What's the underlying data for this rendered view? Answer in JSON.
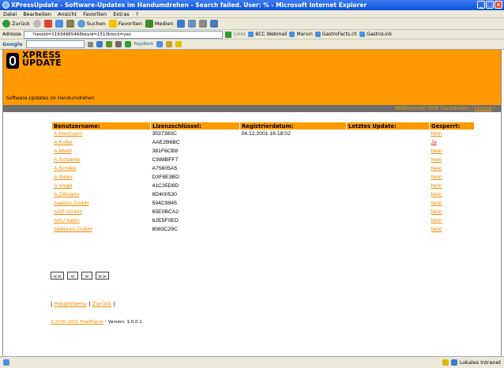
{
  "window": {
    "title": "XPressUpdate - Software-Updates im Handumdrehen - Search failed. User: % - Microsoft Internet Explorer"
  },
  "menu": [
    "Datei",
    "Bearbeiten",
    "Ansicht",
    "Favoriten",
    "Extras",
    "?"
  ],
  "toolbar": {
    "back": "Zurück",
    "search": "Suchen",
    "favorites": "Favoriten",
    "media": "Medien"
  },
  "address": {
    "label": "Adresse",
    "value": "?sessid=11934965468keyid=1510block=yes",
    "links_label": "Links",
    "links": [
      "BCC Webmail",
      "Marvin",
      "GastroFacts.ch",
      "GastroLink"
    ]
  },
  "google": {
    "label": "Google",
    "pagerank": "PageRank"
  },
  "site": {
    "brand_line1": "XPRESS",
    "brand_line2": "UPDATE",
    "tagline": "Software-Updates im Handumdrehen",
    "welcome": "Willkommen Dirk Carstensen |",
    "logout": "Logout",
    "welcome_end": "|"
  },
  "table": {
    "headers": [
      "Benutzername:",
      "Lizenzschlüssel:",
      "Registrierdatum:",
      "Letztes Update:",
      "Gesperrt:"
    ],
    "rows": [
      {
        "user": "A.Hartmann",
        "key": "3537383C",
        "date": "04.12.2001 16:18:02",
        "update": "",
        "locked": "Nein"
      },
      {
        "user": "A.Kofler",
        "key": "AAE2B6BC",
        "date": "",
        "update": "",
        "locked": "Ja"
      },
      {
        "user": "A.Mieth",
        "key": "381F6CB8",
        "date": "",
        "update": "",
        "locked": "Nein"
      },
      {
        "user": "A.Schaefer",
        "key": "C988BFF7",
        "date": "",
        "update": "",
        "locked": "Nein"
      },
      {
        "user": "A.Schilke",
        "key": "A75605A5",
        "date": "",
        "update": "",
        "locked": "Nein"
      },
      {
        "user": "A.Sieler",
        "key": "D3F8E3BD",
        "date": "",
        "update": "",
        "locked": "Nein"
      },
      {
        "user": "A.Vogel",
        "key": "41C35D8D",
        "date": "",
        "update": "",
        "locked": "Nein"
      },
      {
        "user": "A.Zillmann",
        "key": "8D400530",
        "date": "",
        "update": "",
        "locked": "Nein"
      },
      {
        "user": "Aaebris GmbH",
        "key": "594C9945",
        "date": "",
        "update": "",
        "locked": "Nein"
      },
      {
        "user": "AAR GmbH",
        "key": "65E0BCA2",
        "date": "",
        "update": "",
        "locked": "Nein"
      },
      {
        "user": "AAU Aalen",
        "key": "62E5F0ED",
        "date": "",
        "update": "",
        "locked": "Nein"
      },
      {
        "user": "Abilitanis GmbH",
        "key": "8083C29C",
        "date": "",
        "update": "",
        "locked": "Nein"
      }
    ]
  },
  "pager": {
    "first": "<<",
    "prev": "<",
    "next": ">",
    "last": ">>"
  },
  "nav": {
    "sep": "|",
    "home": "Hauptmenu",
    "back": "Zurück"
  },
  "footer": {
    "copyright": "©2000-2001 PixelPlanet",
    "version": " - Version: 1.0.0.1"
  },
  "status": {
    "left": "",
    "zone": "Lokales Intranet"
  }
}
